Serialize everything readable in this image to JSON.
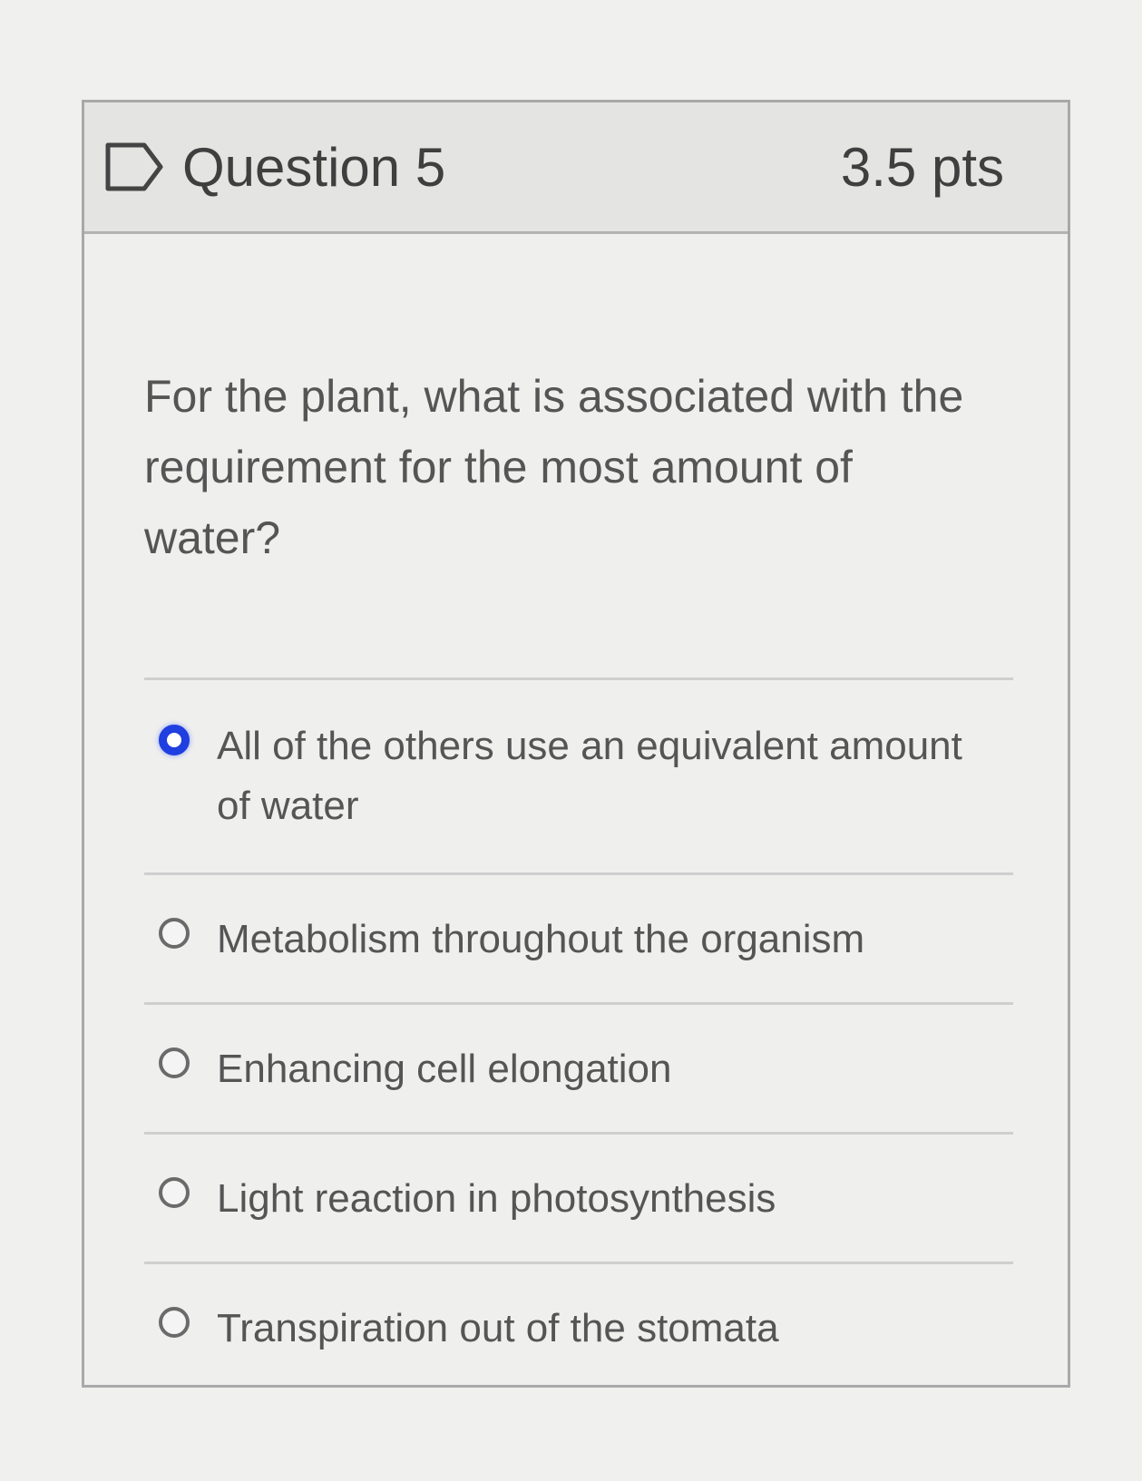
{
  "question": {
    "title": "Question 5",
    "points": "3.5 pts",
    "text": "For the plant, what is associated with the requirement for the most amount of water?",
    "flag_icon": "flag-outline-icon"
  },
  "answers": [
    {
      "label": "All of the others use an equivalent amount of water",
      "selected": true
    },
    {
      "label": "Metabolism throughout the organism",
      "selected": false
    },
    {
      "label": "Enhancing cell elongation",
      "selected": false
    },
    {
      "label": "Light reaction in photosynthesis",
      "selected": false
    },
    {
      "label": "Transpiration out of the stomata",
      "selected": false
    }
  ],
  "colors": {
    "selected_radio": "#1f3fe0",
    "header_bg": "#e4e4e3",
    "border": "#a9a9a9"
  }
}
